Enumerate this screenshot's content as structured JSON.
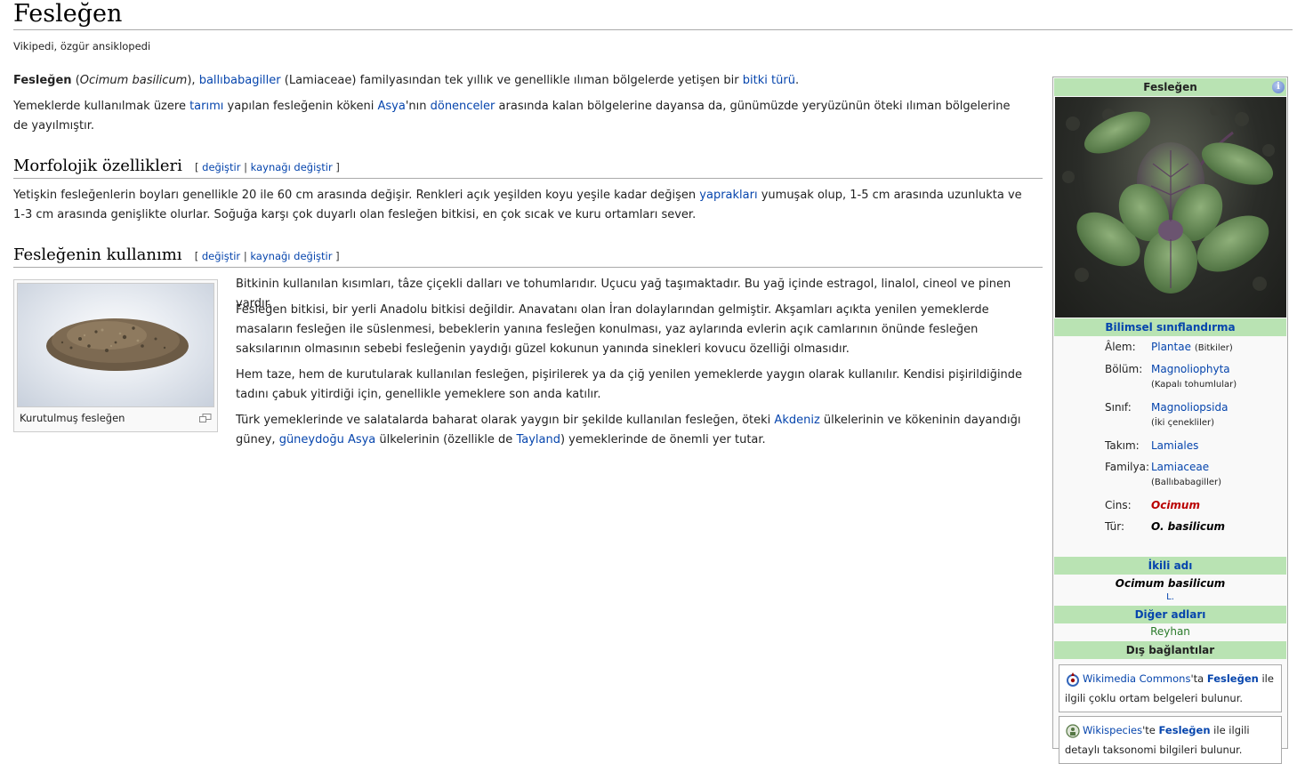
{
  "title": "Fesleğen",
  "subtitle": "Vikipedi, özgür ansiklopedi",
  "intro": {
    "p1": {
      "bold": "Fesleğen",
      "t1": " (",
      "latin": "Ocimum basilicum",
      "t2": "), ",
      "link1": "ballıbabagiller",
      "t3": " (Lamiaceae) familyasından tek yıllık ve genellikle ılıman bölgelerde yetişen bir ",
      "link2": "bitki türü",
      "t4": "."
    },
    "p2": {
      "t1": "Yemeklerde kullanılmak üzere ",
      "link1": "tarımı",
      "t2": " yapılan fesleğenin kökeni ",
      "link2": "Asya",
      "t3": "'nın ",
      "link3": "dönenceler",
      "t4": " arasında kalan bölgelerine dayansa da, günümüzde yeryüzünün öteki ılıman bölgelerine de yayılmıştır."
    }
  },
  "edit": {
    "open": "[",
    "edit_label": "değiştir",
    "sep": "|",
    "source_label": "kaynağı değiştir",
    "close": "]"
  },
  "section1": {
    "heading": "Morfolojik özellikleri",
    "p1": {
      "t1": "Yetişkin fesleğenlerin boyları genellikle 20 ile 60 cm arasında değişir. Renkleri açık yeşilden koyu yeşile kadar değişen ",
      "link1": "yaprakları",
      "t2": " yumuşak olup, 1-5 cm arasında uzunlukta ve 1-3 cm arasında genişlikte olurlar. Soğuğa karşı çok duyarlı olan fesleğen bitkisi, en çok sıcak ve kuru ortamları sever."
    }
  },
  "section2": {
    "heading": "Fesleğenin kullanımı",
    "thumb_caption": "Kurutulmuş fesleğen",
    "p1": "Bitkinin kullanılan kısımları, tâze çiçekli dalları ve tohumlarıdır. Uçucu yağ taşımaktadır. Bu yağ içinde estragol, linalol, cineol ve pinen vardır.",
    "p2": "Fesleğen bitkisi, bir yerli Anadolu bitkisi değildir. Anavatanı olan İran dolaylarından gelmiştir. Akşamları açıkta yenilen yemeklerde masaların fesleğen ile süslenmesi, bebeklerin yanına fesleğen konulması, yaz aylarında evlerin açık camlarının önünde fesleğen saksılarının olmasının sebebi fesleğenin yaydığı güzel kokunun yanında sinekleri kovucu özelliği olmasıdır.",
    "p3": "Hem taze, hem de kurutularak kullanılan fesleğen, pişirilerek ya da çiğ yenilen yemeklerde yaygın olarak kullanılır. Kendisi pişirildiğinde tadını çabuk yitirdiği için, genellikle yemeklere son anda katılır.",
    "p4": {
      "t1": "Türk yemeklerinde ve salatalarda baharat olarak yaygın bir şekilde kullanılan fesleğen, öteki ",
      "link1": "Akdeniz",
      "t2": " ülkelerinin ve kökeninin dayandığı güney, ",
      "link2": "güneydoğu Asya",
      "t3": " ülkelerinin (özellikle de ",
      "link3": "Tayland",
      "t4": ") yemeklerinde de önemli yer tutar."
    }
  },
  "infobox": {
    "title": "Fesleğen",
    "info_icon": "i",
    "classification_header": "Bilimsel sınıflandırma",
    "rows": [
      {
        "label": "Âlem:",
        "value": "Plantae",
        "note": "(Bitkiler)"
      },
      {
        "label": "Bölüm:",
        "value": "Magnoliophyta",
        "note": "(Kapalı tohumlular)"
      },
      {
        "label": "Sınıf:",
        "value": "Magnoliopsida",
        "note": "(İki çenekliler)"
      },
      {
        "label": "Takım:",
        "value": "Lamiales",
        "note": ""
      },
      {
        "label": "Familya:",
        "value": "Lamiaceae",
        "note": "(Ballıbabagiller)"
      },
      {
        "label": "Cins:",
        "value": "Ocimum",
        "note": ""
      },
      {
        "label": "Tür:",
        "value": "O. basilicum",
        "note": ""
      }
    ],
    "binomial_header": "İkili adı",
    "binomial_name": "Ocimum basilicum",
    "binomial_author": "L.",
    "other_names_header": "Diğer adları",
    "other_name": "Reyhan",
    "external_header": "Dış bağlantılar",
    "commons": {
      "link": "Wikimedia Commons",
      "suffix": "'ta ",
      "bold_link": "Fesleğen",
      "rest": " ile ilgili çoklu ortam belgeleri bulunur."
    },
    "species": {
      "link": "Wikispecies",
      "suffix": "'te ",
      "bold_link": "Fesleğen",
      "rest": " ile ilgili detaylı taksonomi bilgileri bulunur."
    }
  },
  "colors": {
    "link": "#0645ad",
    "redlink": "#ba0000",
    "infobox_header": "#b9e3b3"
  }
}
